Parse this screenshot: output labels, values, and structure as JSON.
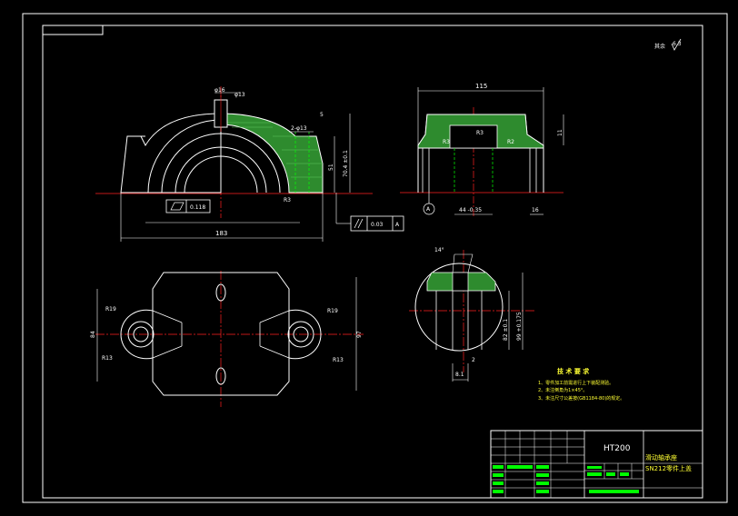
{
  "colors": {
    "background": "#000000",
    "border": "#ffffff",
    "outline": "#ffffff",
    "hidden_lines": "#00ff00",
    "center_lines": "#ff2020",
    "section_fill": "#2e8b2e",
    "notes": "#ffff33"
  },
  "roughness_symbol": {
    "label": "其余",
    "value": "6.3"
  },
  "front_view": {
    "dims": {
      "phi16": "φ16",
      "phi13": "φ13",
      "two_phi13": "2-φ13",
      "five": "5",
      "seventy": "70.4 ±0.1",
      "fifty_one": "51",
      "width": "183",
      "flatness": "0.118",
      "parallelism_value": "0.03",
      "parallelism_datum": "A",
      "r_small": "R3"
    }
  },
  "side_view": {
    "dims": {
      "width": "115",
      "eleven": "11",
      "forty_four": "44 -0.35",
      "sixteen": "16",
      "datum": "A",
      "r_labels": [
        "R3",
        "R3",
        "R2"
      ]
    }
  },
  "top_view": {
    "dims": {
      "r19_left": "R19",
      "r13_left": "R13",
      "r19_right": "R19",
      "r13_right": "R13",
      "eighty_four": "84",
      "ninety_seven": "97"
    }
  },
  "detail_view": {
    "dims": {
      "angle": "14°",
      "eighty_two": "82 ±0.1",
      "ninety_nine": "99 +0.175",
      "eight_one": "8.1",
      "two": "2"
    }
  },
  "technical_requirements": {
    "title": "技 术 要 求",
    "items": [
      "1、零件加工前需进行上下装配测验。",
      "2、未注倒角为1×45°。",
      "3、未注尺寸公差按(GB1184-80)的规定。"
    ]
  },
  "title_block": {
    "material": "HT200",
    "name_line1": "滑动轴承座",
    "name_line2": "SN212零件上盖"
  }
}
